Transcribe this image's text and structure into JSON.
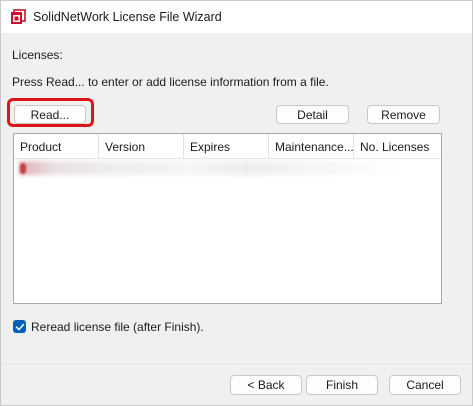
{
  "window": {
    "title": "SolidNetWork License File Wizard"
  },
  "content": {
    "licenses_label": "Licenses:",
    "instruction": "Press Read... to enter or add license information from a file."
  },
  "buttons": {
    "read": "Read...",
    "detail": "Detail",
    "remove": "Remove"
  },
  "table": {
    "columns": [
      "Product",
      "Version",
      "Expires",
      "Maintenance...",
      "No. Licenses"
    ]
  },
  "options": {
    "reread_label": "Reread license file (after Finish).",
    "reread_checked": true
  },
  "footer": {
    "back": "< Back",
    "finish": "Finish",
    "cancel": "Cancel"
  },
  "colors": {
    "highlight": "#e0141b",
    "checkbox": "#005fb8"
  }
}
